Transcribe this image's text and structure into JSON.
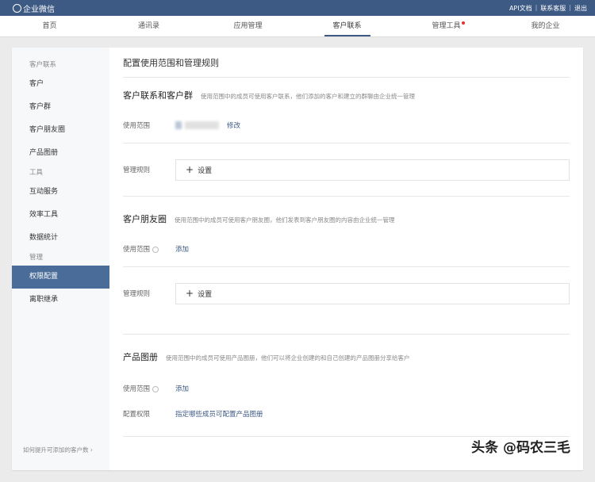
{
  "header": {
    "logo": "企业微信",
    "links": [
      "API文档",
      "联系客服",
      "退出"
    ]
  },
  "nav": [
    "首页",
    "通讯录",
    "应用管理",
    "客户联系",
    "管理工具",
    "我的企业"
  ],
  "sidebar": {
    "groups": [
      {
        "title": "客户联系",
        "items": [
          "客户",
          "客户群",
          "客户朋友圈",
          "产品图册"
        ]
      },
      {
        "title": "工具",
        "items": [
          "互动服务",
          "效率工具",
          "数据统计"
        ]
      },
      {
        "title": "管理",
        "items": [
          "权限配置",
          "离职继承"
        ]
      }
    ],
    "footer": "如何提升可添加的客户数 ›"
  },
  "main": {
    "title": "配置使用范围和管理规则",
    "s1": {
      "title": "客户联系和客户群",
      "desc": "使用范围中的成员可使用客户联系，他们添加的客户和建立的群聊由企业统一管理",
      "scope_label": "使用范围",
      "modify": "修改",
      "rule_label": "管理规则",
      "set": "设置"
    },
    "s2": {
      "title": "客户朋友圈",
      "desc": "使用范围中的成员可使用客户朋友圈，他们发表到客户朋友圈的内容由企业统一管理",
      "scope_label": "使用范围",
      "add": "添加",
      "rule_label": "管理规则",
      "set": "设置"
    },
    "s3": {
      "title": "产品图册",
      "desc": "使用范围中的成员可使用产品图册，他们可以将企业创建的和自己创建的产品图册分享给客户",
      "scope_label": "使用范围",
      "add": "添加",
      "perm_label": "配置权限",
      "perm_link": "指定哪些成员可配置产品图册"
    }
  },
  "watermark": "头条 @码农三毛"
}
